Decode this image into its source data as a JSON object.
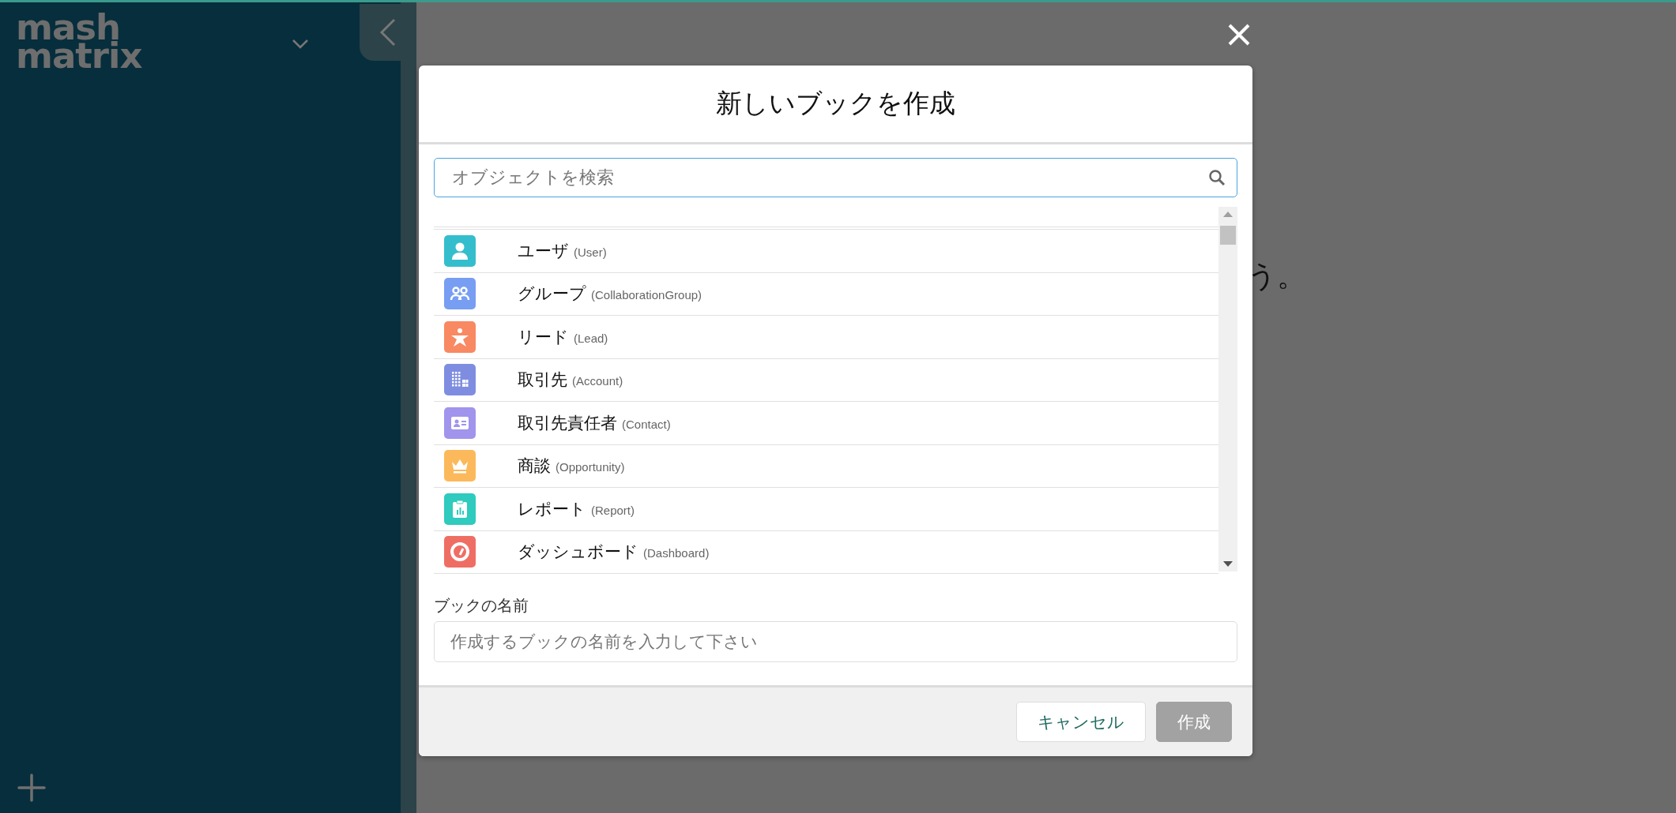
{
  "sidebar": {
    "logo": [
      "mash",
      "matrix"
    ]
  },
  "background": {
    "text_fragment": "う。"
  },
  "dialog": {
    "title": "新しいブックを作成",
    "search": {
      "placeholder": "オブジェクトを検索"
    },
    "objects": [
      {
        "label": "ユーザ",
        "api_name": "(User)",
        "kind": "user",
        "color": "#34becd"
      },
      {
        "label": "グループ",
        "api_name": "(CollaborationGroup)",
        "kind": "group",
        "color": "#779ef2"
      },
      {
        "label": "リード",
        "api_name": "(Lead)",
        "kind": "lead",
        "color": "#f88962"
      },
      {
        "label": "取引先",
        "api_name": "(Account)",
        "kind": "account",
        "color": "#7f8de1"
      },
      {
        "label": "取引先責任者",
        "api_name": "(Contact)",
        "kind": "contact",
        "color": "#a094ed"
      },
      {
        "label": "商談",
        "api_name": "(Opportunity)",
        "kind": "opportunity",
        "color": "#fcb95b"
      },
      {
        "label": "レポート",
        "api_name": "(Report)",
        "kind": "report",
        "color": "#2ecbbe"
      },
      {
        "label": "ダッシュボード",
        "api_name": "(Dashboard)",
        "kind": "dashboard",
        "color": "#ef6e64"
      }
    ],
    "name_field": {
      "label": "ブックの名前",
      "placeholder": "作成するブックの名前を入力して下さい"
    },
    "buttons": [
      {
        "label": "キャンセル",
        "disabled": false
      },
      {
        "label": "作成",
        "disabled": true
      }
    ]
  }
}
